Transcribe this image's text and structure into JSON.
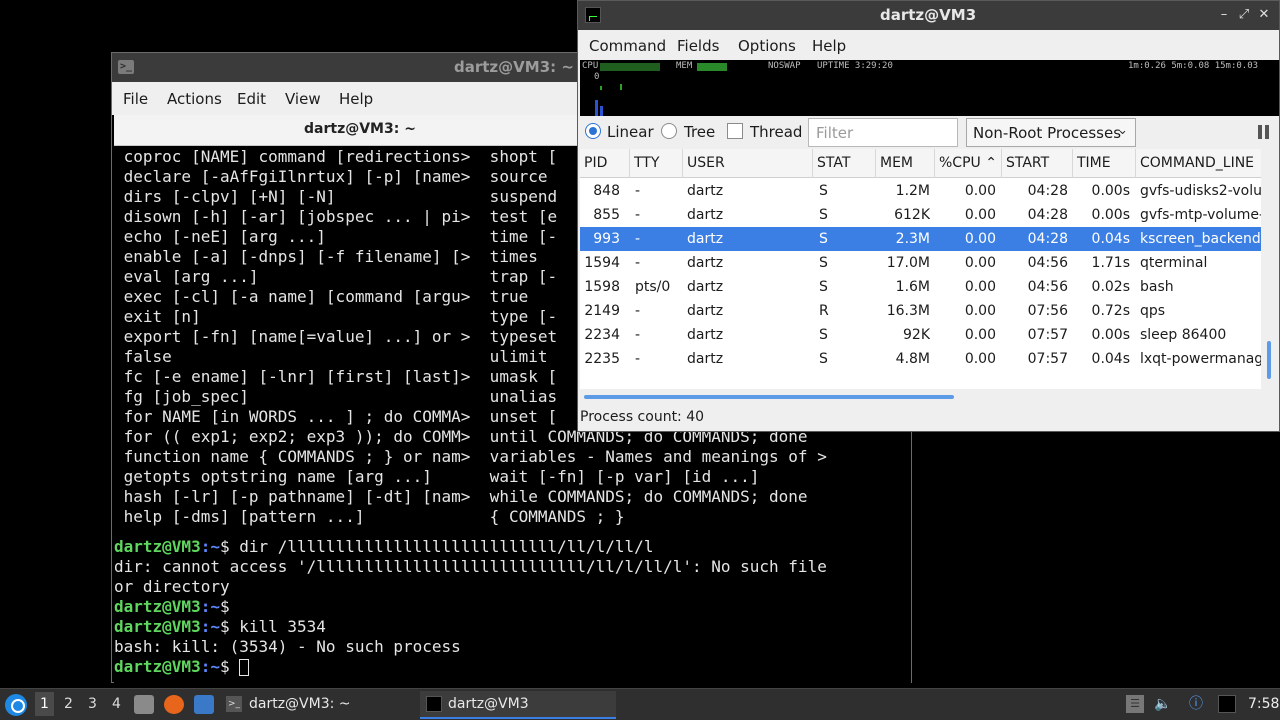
{
  "terminal": {
    "title": "dartz@VM3: ~",
    "menu": [
      "File",
      "Actions",
      "Edit",
      "View",
      "Help"
    ],
    "tab": "dartz@VM3: ~",
    "help_lines": [
      " coproc [NAME] command [redirections>  shopt [",
      " declare [-aAfFgiIlnrtux] [-p] [name>  source",
      " dirs [-clpv] [+N] [-N]                suspend",
      " disown [-h] [-ar] [jobspec ... | pi>  test [e",
      " echo [-neE] [arg ...]                 time [-",
      " enable [-a] [-dnps] [-f filename] [>  times",
      " eval [arg ...]                        trap [-",
      " exec [-cl] [-a name] [command [argu>  true",
      " exit [n]                              type [-",
      " export [-fn] [name[=value] ...] or >  typeset",
      " false                                 ulimit",
      " fc [-e ename] [-lnr] [first] [last]>  umask [",
      " fg [job_spec]                         unalias",
      " for NAME [in WORDS ... ] ; do COMMA>  unset [",
      " for (( exp1; exp2; exp3 )); do COMM>  until COMMANDS; do COMMANDS; done",
      " function name { COMMANDS ; } or nam>  variables - Names and meanings of >",
      " getopts optstring name [arg ...]      wait [-fn] [-p var] [id ...]",
      " hash [-lr] [-p pathname] [-dt] [nam>  while COMMANDS; do COMMANDS; done",
      " help [-dms] [pattern ...]             { COMMANDS ; }"
    ],
    "prompt_user": "dartz@VM3",
    "prompt_path": ":~",
    "prompt_sign": "$ ",
    "cmd1": "dir /llllllllllllllllllllllllllll/ll/l/ll/l",
    "err1a": "dir: cannot access '/llllllllllllllllllllllllllll/ll/l/ll/l': No such file",
    "err1b": "or directory",
    "cmd2": "kill 3534",
    "err2": "bash: kill: (3534) - No such process"
  },
  "qps": {
    "title": "dartz@VM3",
    "menu": [
      "Command",
      "Fields",
      "Options",
      "Help"
    ],
    "graph": {
      "cpu_label": "CPU",
      "cpu_zero": "0",
      "mem_label": "MEM",
      "noswap": "NOSWAP",
      "uptime": "UPTIME 3:29:20",
      "load": "1m:0.26 5m:0.08 15m:0.03"
    },
    "view_modes": [
      "Linear",
      "Tree"
    ],
    "thread_label": "Thread",
    "filter_placeholder": "Filter",
    "process_filter": "Non-Root Processes",
    "columns": [
      "PID",
      "TTY",
      "USER",
      "STAT",
      "MEM",
      "%CPU",
      "START",
      "TIME",
      "COMMAND_LINE"
    ],
    "sort_column": "%CPU",
    "rows": [
      {
        "pid": "848",
        "tty": "-",
        "user": "dartz",
        "stat": "S",
        "mem": "1.2M",
        "cpu": "0.00",
        "start": "04:28",
        "time": "0.00s",
        "cmd": "gvfs-udisks2-volu"
      },
      {
        "pid": "855",
        "tty": "-",
        "user": "dartz",
        "stat": "S",
        "mem": "612K",
        "cpu": "0.00",
        "start": "04:28",
        "time": "0.00s",
        "cmd": "gvfs-mtp-volume-"
      },
      {
        "pid": "993",
        "tty": "-",
        "user": "dartz",
        "stat": "S",
        "mem": "2.3M",
        "cpu": "0.00",
        "start": "04:28",
        "time": "0.04s",
        "cmd": "kscreen_backend"
      },
      {
        "pid": "1594",
        "tty": "-",
        "user": "dartz",
        "stat": "S",
        "mem": "17.0M",
        "cpu": "0.00",
        "start": "04:56",
        "time": "1.71s",
        "cmd": "qterminal"
      },
      {
        "pid": "1598",
        "tty": "pts/0",
        "user": "dartz",
        "stat": "S",
        "mem": "1.6M",
        "cpu": "0.00",
        "start": "04:56",
        "time": "0.02s",
        "cmd": "bash"
      },
      {
        "pid": "2149",
        "tty": "-",
        "user": "dartz",
        "stat": "R",
        "mem": "16.3M",
        "cpu": "0.00",
        "start": "07:56",
        "time": "0.72s",
        "cmd": "qps"
      },
      {
        "pid": "2234",
        "tty": "-",
        "user": "dartz",
        "stat": "S",
        "mem": "92K",
        "cpu": "0.00",
        "start": "07:57",
        "time": "0.00s",
        "cmd": "sleep 86400"
      },
      {
        "pid": "2235",
        "tty": "-",
        "user": "dartz",
        "stat": "S",
        "mem": "4.8M",
        "cpu": "0.00",
        "start": "07:57",
        "time": "0.04s",
        "cmd": "lxqt-powermanag"
      }
    ],
    "selected_pid": "993",
    "status": "Process count: 40"
  },
  "taskbar": {
    "workspaces": [
      "1",
      "2",
      "3",
      "4"
    ],
    "active_workspace": "1",
    "tasks": [
      "dartz@VM3: ~",
      "dartz@VM3"
    ],
    "clock": "7:58"
  },
  "colors": {
    "selection": "#3b7fe4",
    "prompt_user": "#5fd75f",
    "prompt_path": "#5f87ff"
  }
}
